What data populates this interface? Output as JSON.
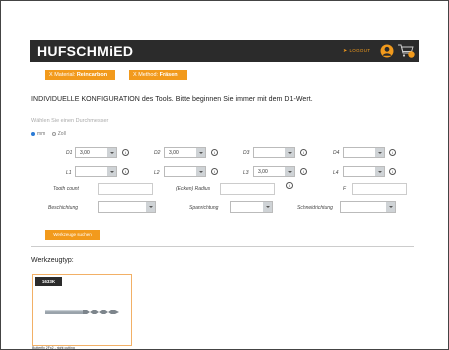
{
  "header": {
    "brand": "HUFSCHMiED",
    "logout_label": "LOGOUT",
    "logout_icon": "logout-arrow-icon",
    "user_icon": "user-icon",
    "cart_icon": "cart-icon",
    "accent_color": "#f29a1c"
  },
  "filters": {
    "material_prefix": "X Material: ",
    "material_value": "Reincarbon",
    "method_prefix": "X Method: ",
    "method_value": "Fräsen"
  },
  "config": {
    "headline": "INDIVIDUELLE KONFIGURATION des Tools. Bitte beginnen Sie immer mit dem D1-Wert.",
    "diameter_label": "Wählen Sie einen Durchmesser",
    "unit_mm": "mm",
    "unit_inch": "Zoll",
    "unit_selected": "mm"
  },
  "dimensions": {
    "d1": {
      "label": "D1",
      "value": "3,00"
    },
    "d2": {
      "label": "D2",
      "value": "3,00"
    },
    "d3": {
      "label": "D3",
      "value": ""
    },
    "d4": {
      "label": "D4",
      "value": ""
    },
    "l1": {
      "label": "L1",
      "value": ""
    },
    "l2": {
      "label": "L2",
      "value": ""
    },
    "l3": {
      "label": "L3",
      "value": "3,00"
    },
    "l4": {
      "label": "L4",
      "value": ""
    }
  },
  "extras": {
    "tooth_count_label": "Tooth count",
    "corner_radius_label": "(Ecken) Radius",
    "f_label": "F",
    "coating_label": "Beschichtung",
    "chip_breaker_label": "Spanrichtung",
    "cutting_direction_label": "Schneidrichtung"
  },
  "actions": {
    "search_label": "Werkzeuge suchen"
  },
  "results": {
    "title": "Werkzeugtyp:",
    "cards": [
      {
        "badge": "1633K",
        "caption": "Butterfly 2Fx2 - right cutting"
      }
    ]
  }
}
